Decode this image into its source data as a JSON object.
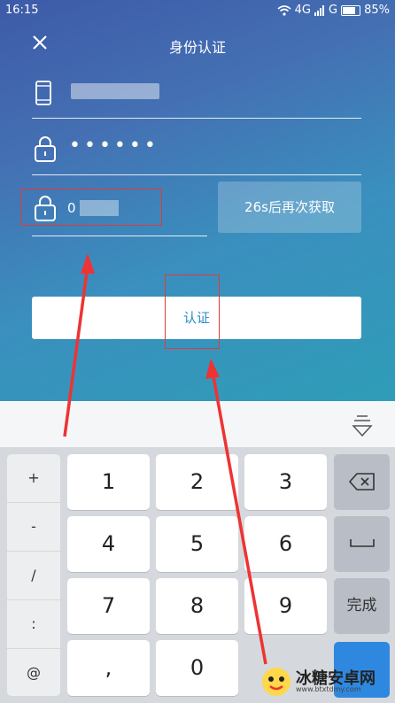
{
  "status_bar": {
    "time": "16:15",
    "network": "4G",
    "signal_text": "G",
    "battery": "85%"
  },
  "header": {
    "title": "身份认证"
  },
  "form": {
    "password_dots": "••••••",
    "code_value": "0",
    "resend_label": "26s后再次获取",
    "confirm_label": "认证"
  },
  "keyboard": {
    "symbols": [
      "+",
      "-",
      "/",
      ":",
      "@"
    ],
    "digits": [
      "1",
      "2",
      "3",
      "4",
      "5",
      "6",
      "7",
      "8",
      "9",
      ",",
      "0"
    ],
    "done_label": "完成"
  },
  "watermark": {
    "title": "冰糖安卓网",
    "url": "www.btxtdmy.com"
  },
  "colors": {
    "accent": "#2a8fc6",
    "annotation": "#e03a3a",
    "keyboard_blue": "#2f88e0"
  }
}
